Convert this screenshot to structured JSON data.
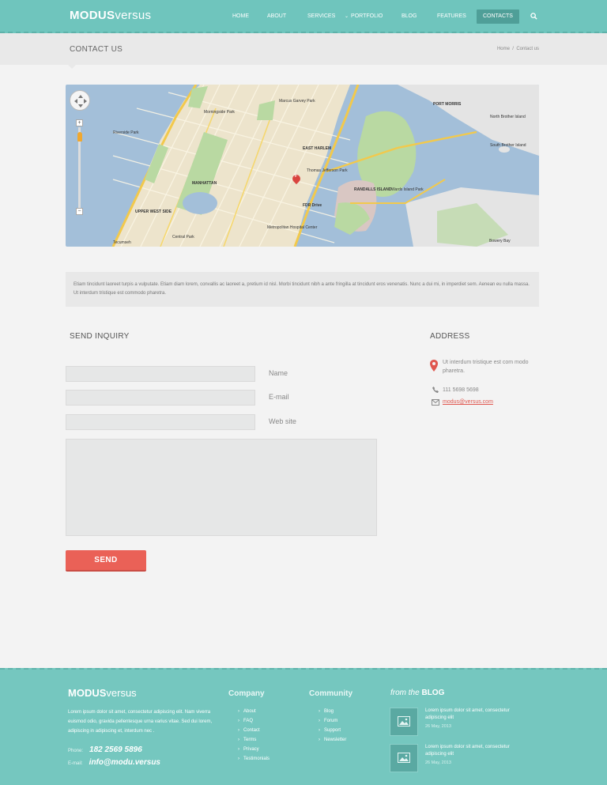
{
  "header": {
    "logo_bold": "MODUS",
    "logo_light": "versus",
    "nav": [
      "HOME",
      "ABOUT",
      "SERVICES",
      "PORTFOLIO",
      "BLOG",
      "FEATURES",
      "CONTACTS"
    ],
    "active": "CONTACTS"
  },
  "titlebar": {
    "title": "CONTACT US",
    "breadcrumb_home": "Home",
    "breadcrumb_sep": "/",
    "breadcrumb_current": "Contact us"
  },
  "map": {
    "labels": [
      "MANHATTAN",
      "UPPER WEST SIDE",
      "EAST HARLEM",
      "RANDALLS ISLAND",
      "PORT MORRIS",
      "Central Park",
      "Thomas Jefferson Park",
      "Wards Island Park",
      "North Brother Island",
      "South Brother Island",
      "Riverside Park",
      "Marcus Garvey Park",
      "Metropolitan Hospital Center",
      "Morningside Park",
      "FDR Drive",
      "Bowery Bay",
      "Tecumseh"
    ],
    "pin_letter": "F"
  },
  "info": {
    "text": "Etiam tincidunt laoreet turpis a vulputate. Etiam diam lorem, convallis ac laoreet a, pretium id nisl. Morbi tincidunt nibh a ante fringilla at tincidunt eros venenatis. Nunc a dui mi, in imperdiet sem. Aenean eu nulla massa. Ut interdum tristique est commodo pharetra."
  },
  "form": {
    "title": "SEND INQUIRY",
    "name_label": "Name",
    "email_label": "E-mail",
    "website_label": "Web site",
    "send_label": "SEND"
  },
  "address": {
    "title": "ADDRESS",
    "location": "Ut interdum tristique est com modo pharetra.",
    "phone": "111 5698 5698",
    "email": "modus@versus.com"
  },
  "footer": {
    "logo_bold": "MODUS",
    "logo_light": "versus",
    "text": "Lorem ipsum dolor sit amet, consectetur adipiscing elit. Nam viverra euismod odio, gravida pellentesque urna varius vitae. Sed dui lorem, adipiscing in adipiscing et, interdum nec .",
    "phone_label": "Phone:",
    "phone": "182 2569 5896",
    "email_label": "E-mail:",
    "email": "info@modu.versus",
    "company_title": "Company",
    "company_links": [
      "About",
      "FAQ",
      "Contact",
      "Terms",
      "Privacy",
      "Testimonials"
    ],
    "community_title": "Community",
    "community_links": [
      "Blog",
      "Forum",
      "Support",
      "Newsletter"
    ],
    "blog_prefix": "from the",
    "blog_title": "BLOG",
    "posts": [
      {
        "title": "Lorem ipsum dolor sit amet, consectetur adipiscing elit",
        "date": "26 May, 2013"
      },
      {
        "title": "Lorem ipsum dolor sit amet, consectetur adipiscing elit",
        "date": "26 May, 2013"
      }
    ]
  },
  "colors": {
    "teal": "#6fc5bd",
    "accent_red": "#ea6157",
    "dark_teal": "#4f9f98"
  }
}
